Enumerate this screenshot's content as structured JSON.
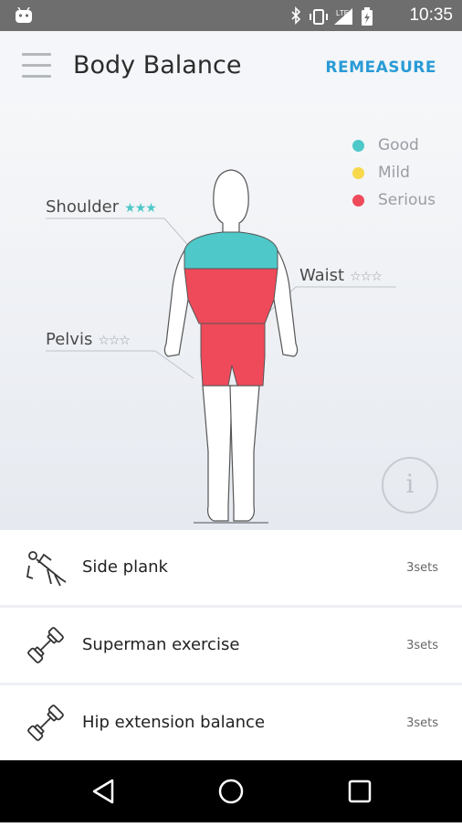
{
  "status_bar": {
    "time": "10:35"
  },
  "header": {
    "title": "Body Balance",
    "remeasure": "REMEASURE"
  },
  "legend": [
    {
      "label": "Good",
      "color": "#4ec8c8"
    },
    {
      "label": "Mild",
      "color": "#f7d84b"
    },
    {
      "label": "Serious",
      "color": "#ef4a5a"
    }
  ],
  "body_parts": {
    "shoulder": {
      "label": "Shoulder",
      "stars": "★★★",
      "star_color": "#4ec8c8",
      "status_color": "#4ec8c8"
    },
    "waist": {
      "label": "Waist",
      "stars": "☆☆☆",
      "star_color": "#9a9da3",
      "status_color": "#ef4a5a"
    },
    "pelvis": {
      "label": "Pelvis",
      "stars": "☆☆☆",
      "star_color": "#9a9da3",
      "status_color": "#ef4a5a"
    }
  },
  "info_button": {
    "label": "i"
  },
  "exercises": [
    {
      "name": "Side plank",
      "sets": "3sets",
      "icon": "side-plank-icon"
    },
    {
      "name": "Superman exercise",
      "sets": "3sets",
      "icon": "dumbbell-icon"
    },
    {
      "name": "Hip extension balance",
      "sets": "3sets",
      "icon": "dumbbell-icon"
    }
  ]
}
